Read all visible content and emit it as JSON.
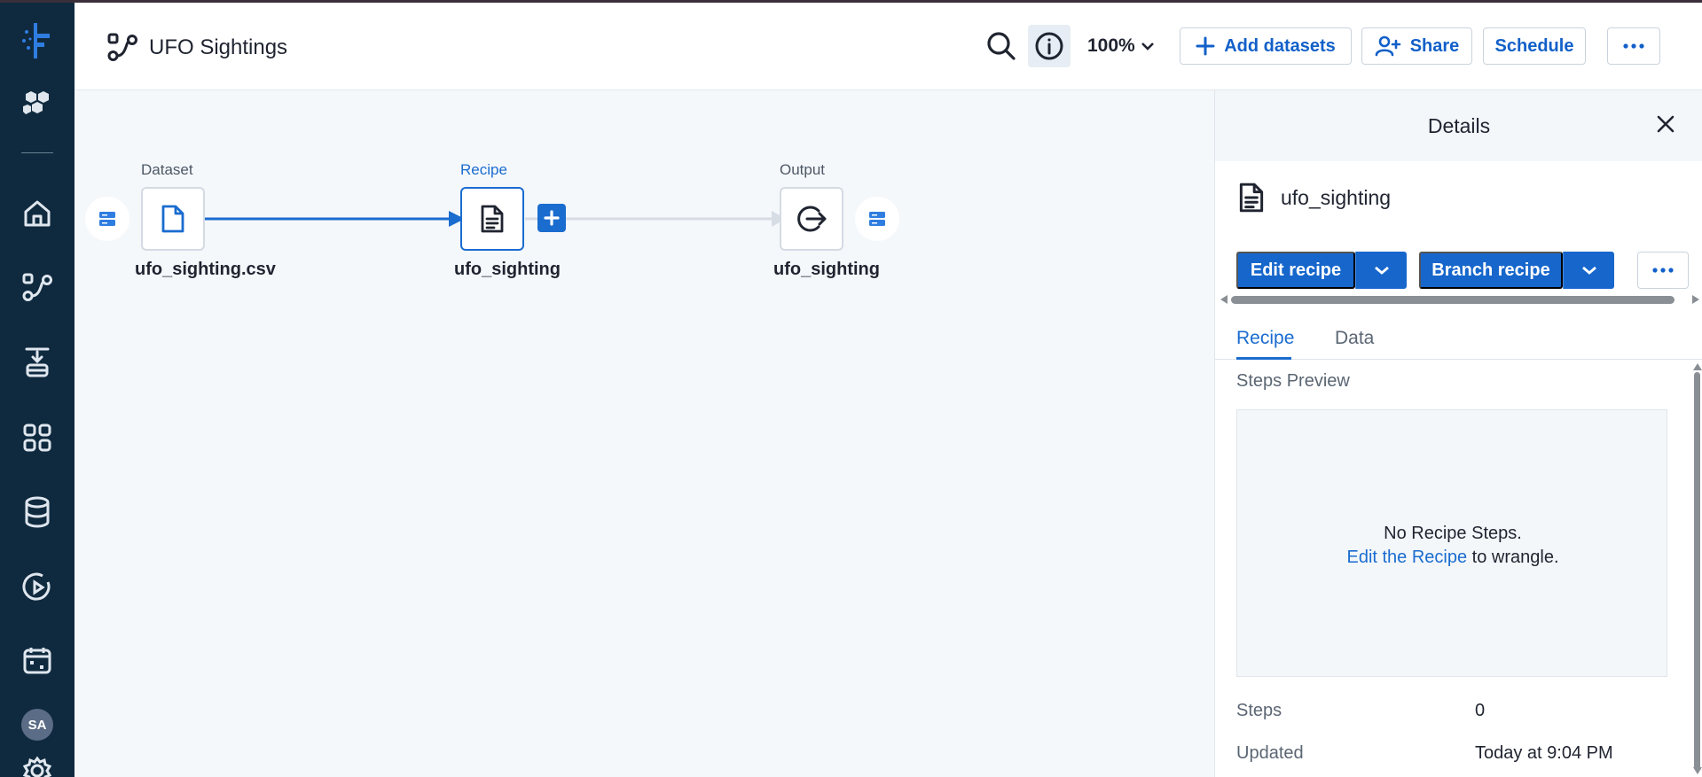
{
  "header": {
    "flow_title": "UFO Sightings",
    "zoom": "100%",
    "add_datasets": "Add datasets",
    "share": "Share",
    "schedule": "Schedule"
  },
  "flow": {
    "dataset": {
      "type_label": "Dataset",
      "name": "ufo_sighting.csv"
    },
    "recipe": {
      "type_label": "Recipe",
      "name": "ufo_sighting"
    },
    "output": {
      "type_label": "Output",
      "name": "ufo_sighting"
    }
  },
  "details": {
    "title": "Details",
    "item_name": "ufo_sighting",
    "edit_recipe": "Edit recipe",
    "branch_recipe": "Branch recipe",
    "tabs": [
      {
        "label": "Recipe",
        "active": true
      },
      {
        "label": "Data",
        "active": false
      }
    ],
    "steps_preview_label": "Steps Preview",
    "empty_line1": "No Recipe Steps.",
    "empty_link": "Edit the Recipe",
    "empty_line2_suffix": " to wrangle.",
    "meta": [
      {
        "key": "Steps",
        "value": "0"
      },
      {
        "key": "Updated",
        "value": "Today at 9:04 PM"
      }
    ]
  },
  "user": {
    "initials": "SA"
  },
  "colors": {
    "rail": "#0f2a3f",
    "accent": "#1a6ccf",
    "primary_button": "#1666cc"
  },
  "icons": [
    "logo-icon",
    "hexagons-icon",
    "home-icon",
    "flow-icon",
    "import-icon",
    "apps-icon",
    "database-icon",
    "play-circle-icon",
    "calendar-icon",
    "settings-icon"
  ]
}
